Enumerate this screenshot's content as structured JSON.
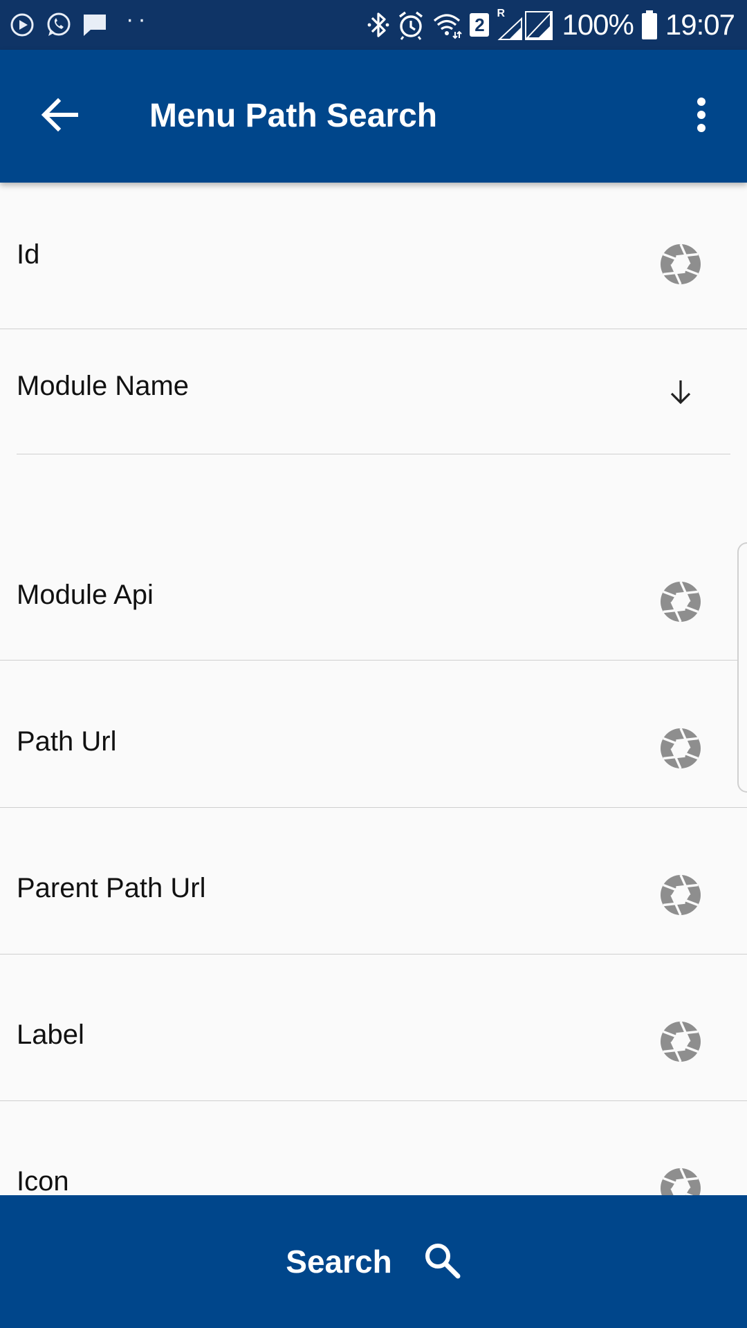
{
  "status_bar": {
    "battery": "100%",
    "time": "19:07",
    "sim_badge": "2",
    "roaming_label": "R",
    "left_dots": "··",
    "icons": [
      "play-circle-icon",
      "whatsapp-icon",
      "message-icon",
      "bluetooth-icon",
      "alarm-icon",
      "wifi-icon",
      "signal-icon",
      "battery-icon"
    ]
  },
  "app_bar": {
    "title": "Menu Path Search",
    "back_icon": "arrow-back-icon",
    "menu_icon": "more-vert-icon"
  },
  "form": {
    "fields": [
      {
        "label": "Id",
        "icon": "aperture-icon"
      },
      {
        "label": "Module Name",
        "icon": "arrow-down-icon"
      },
      {
        "label": "Module Api",
        "icon": "aperture-icon"
      },
      {
        "label": "Path Url",
        "icon": "aperture-icon"
      },
      {
        "label": "Parent Path Url",
        "icon": "aperture-icon"
      },
      {
        "label": "Label",
        "icon": "aperture-icon"
      },
      {
        "label": "Icon",
        "icon": "aperture-icon"
      }
    ]
  },
  "bottom_button": {
    "label": "Search",
    "icon": "search-icon"
  },
  "colors": {
    "status_bar": "#0f3466",
    "app_bar": "#00468b",
    "background": "#fafafa",
    "divider": "#cfcfcf",
    "icon_gray": "#8e8e8e"
  }
}
